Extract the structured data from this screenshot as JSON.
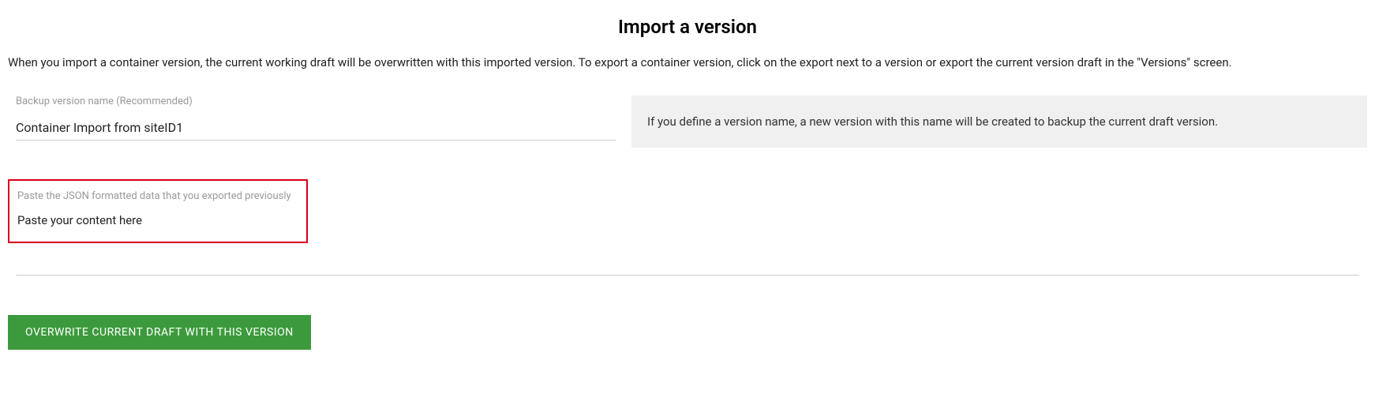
{
  "title": "Import a version",
  "description": "When you import a container version, the current working draft will be overwritten with this imported version. To export a container version, click on the export next to a version or export the current version draft in the \"Versions\" screen.",
  "backup": {
    "label": "Backup version name (Recommended)",
    "value": "Container Import from siteID1"
  },
  "info_text": "If you define a version name, a new version with this name will be created to backup the current draft version.",
  "paste": {
    "label": "Paste the JSON formatted data that you exported previously",
    "placeholder": "Paste your content here"
  },
  "button_label": "OVERWRITE CURRENT DRAFT WITH THIS VERSION"
}
